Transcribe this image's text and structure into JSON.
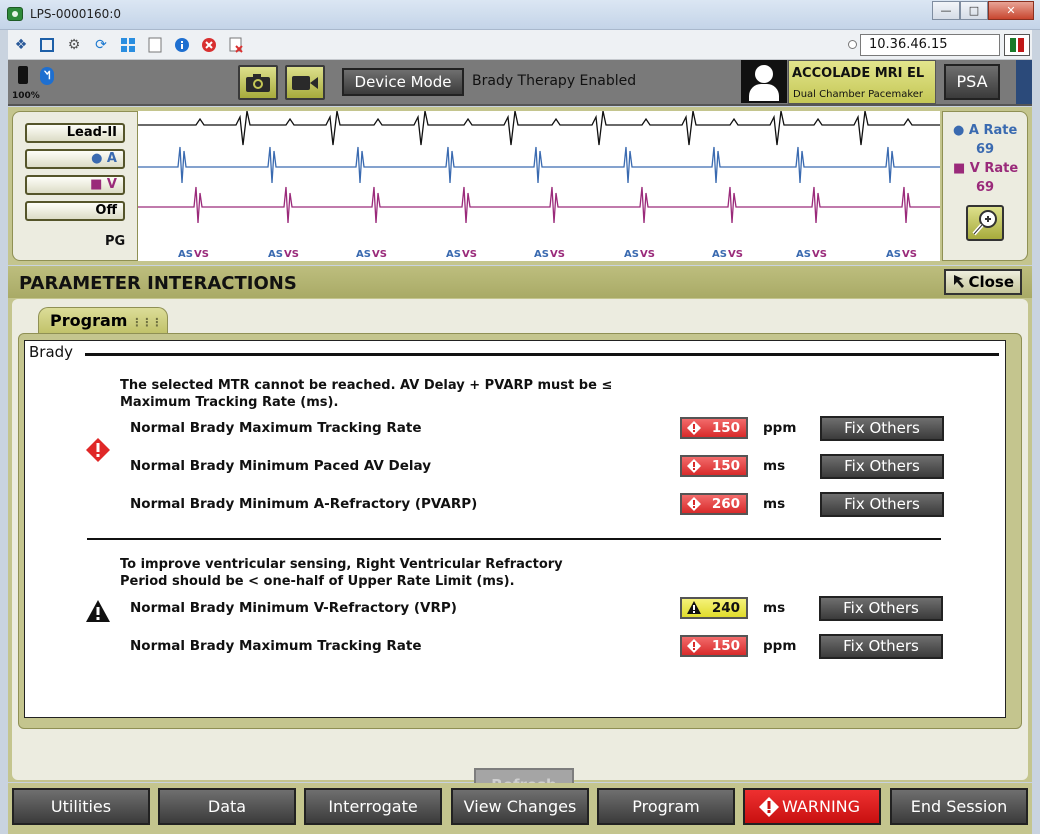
{
  "window": {
    "title": "LPS-0000160:0"
  },
  "toolbar": {
    "ip_address": "10.36.46.15"
  },
  "header": {
    "battery_label": "100%",
    "device_mode_label": "Device Mode",
    "status_text": "Brady Therapy Enabled",
    "device_name": "ACCOLADE MRI EL",
    "device_type": "Dual Chamber Pacemaker",
    "psa_label": "PSA"
  },
  "ecg": {
    "lead_buttons": [
      "Lead-II",
      "● A",
      "■ V",
      "Off"
    ],
    "pg_label": "PG",
    "a_rate_label": "● A Rate",
    "a_rate_value": "69",
    "v_rate_label": "■ V Rate",
    "v_rate_value": "69",
    "markers_as": "AS",
    "markers_vs": "VS",
    "colors": {
      "a": "#3a6ab0",
      "v": "#9a2a7a",
      "lead": "#111111"
    }
  },
  "panel": {
    "title": "PARAMETER INTERACTIONS",
    "close_label": "Close",
    "tab_label": "Program",
    "section_title": "Brady",
    "group1_message": "The selected MTR cannot be reached. AV Delay + PVARP must be ≤ Maximum Tracking Rate (ms).",
    "group1_msg_line1": "The selected MTR cannot be reached. AV Delay + PVARP must be ≤",
    "group1_msg_line2": "Maximum Tracking Rate (ms).",
    "group2_msg_line1": "To improve ventricular sensing, Right Ventricular Refractory",
    "group2_msg_line2": "Period should be < one-half of Upper Rate Limit (ms).",
    "rows": [
      {
        "name": "Normal Brady Maximum Tracking Rate",
        "value": "150",
        "unit": "ppm",
        "severity": "error",
        "button": "Fix Others"
      },
      {
        "name": "Normal Brady Minimum Paced AV Delay",
        "value": "150",
        "unit": "ms",
        "severity": "error",
        "button": "Fix Others"
      },
      {
        "name": "Normal Brady Minimum A-Refractory (PVARP)",
        "value": "260",
        "unit": "ms",
        "severity": "error",
        "button": "Fix Others"
      },
      {
        "name": "Normal Brady Minimum V-Refractory (VRP)",
        "value": "240",
        "unit": "ms",
        "severity": "warning",
        "button": "Fix Others"
      },
      {
        "name": "Normal Brady Maximum Tracking Rate",
        "value": "150",
        "unit": "ppm",
        "severity": "error",
        "button": "Fix Others"
      }
    ],
    "refresh_label": "Refresh"
  },
  "nav": {
    "buttons": [
      "Utilities",
      "Data",
      "Interrogate",
      "View Changes",
      "Program",
      "WARNING",
      "End Session"
    ]
  }
}
